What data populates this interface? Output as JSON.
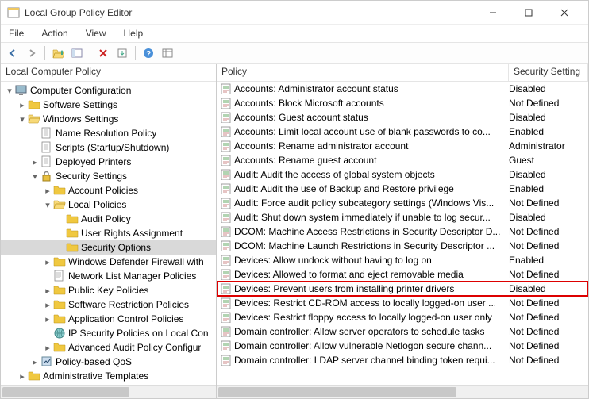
{
  "window": {
    "title": "Local Group Policy Editor"
  },
  "menu": {
    "file": "File",
    "action": "Action",
    "view": "View",
    "help": "Help"
  },
  "tree_header": "Local Computer Policy",
  "tree": [
    {
      "indent": 0,
      "tw": "▾",
      "label": "Computer Configuration",
      "icon": "computer",
      "sel": false
    },
    {
      "indent": 1,
      "tw": "▸",
      "label": "Software Settings",
      "icon": "folder",
      "sel": false
    },
    {
      "indent": 1,
      "tw": "▾",
      "label": "Windows Settings",
      "icon": "folder-open",
      "sel": false
    },
    {
      "indent": 2,
      "tw": "",
      "label": "Name Resolution Policy",
      "icon": "page",
      "sel": false
    },
    {
      "indent": 2,
      "tw": "",
      "label": "Scripts (Startup/Shutdown)",
      "icon": "page",
      "sel": false
    },
    {
      "indent": 2,
      "tw": "▸",
      "label": "Deployed Printers",
      "icon": "page",
      "sel": false
    },
    {
      "indent": 2,
      "tw": "▾",
      "label": "Security Settings",
      "icon": "lock",
      "sel": false
    },
    {
      "indent": 3,
      "tw": "▸",
      "label": "Account Policies",
      "icon": "folder",
      "sel": false
    },
    {
      "indent": 3,
      "tw": "▾",
      "label": "Local Policies",
      "icon": "folder-open",
      "sel": false
    },
    {
      "indent": 4,
      "tw": "",
      "label": "Audit Policy",
      "icon": "folder",
      "sel": false
    },
    {
      "indent": 4,
      "tw": "",
      "label": "User Rights Assignment",
      "icon": "folder",
      "sel": false
    },
    {
      "indent": 4,
      "tw": "",
      "label": "Security Options",
      "icon": "folder",
      "sel": true
    },
    {
      "indent": 3,
      "tw": "▸",
      "label": "Windows Defender Firewall with",
      "icon": "folder",
      "sel": false
    },
    {
      "indent": 3,
      "tw": "",
      "label": "Network List Manager Policies",
      "icon": "page",
      "sel": false
    },
    {
      "indent": 3,
      "tw": "▸",
      "label": "Public Key Policies",
      "icon": "folder",
      "sel": false
    },
    {
      "indent": 3,
      "tw": "▸",
      "label": "Software Restriction Policies",
      "icon": "folder",
      "sel": false
    },
    {
      "indent": 3,
      "tw": "▸",
      "label": "Application Control Policies",
      "icon": "folder",
      "sel": false
    },
    {
      "indent": 3,
      "tw": "",
      "label": "IP Security Policies on Local Con",
      "icon": "globe",
      "sel": false
    },
    {
      "indent": 3,
      "tw": "▸",
      "label": "Advanced Audit Policy Configur",
      "icon": "folder",
      "sel": false
    },
    {
      "indent": 2,
      "tw": "▸",
      "label": "Policy-based QoS",
      "icon": "pbqos",
      "sel": false
    },
    {
      "indent": 1,
      "tw": "▸",
      "label": "Administrative Templates",
      "icon": "folder",
      "sel": false
    }
  ],
  "columns": {
    "policy": "Policy",
    "setting": "Security Setting"
  },
  "policies": [
    {
      "name": "Accounts: Administrator account status",
      "setting": "Disabled",
      "hl": false
    },
    {
      "name": "Accounts: Block Microsoft accounts",
      "setting": "Not Defined",
      "hl": false
    },
    {
      "name": "Accounts: Guest account status",
      "setting": "Disabled",
      "hl": false
    },
    {
      "name": "Accounts: Limit local account use of blank passwords to co...",
      "setting": "Enabled",
      "hl": false
    },
    {
      "name": "Accounts: Rename administrator account",
      "setting": "Administrator",
      "hl": false
    },
    {
      "name": "Accounts: Rename guest account",
      "setting": "Guest",
      "hl": false
    },
    {
      "name": "Audit: Audit the access of global system objects",
      "setting": "Disabled",
      "hl": false
    },
    {
      "name": "Audit: Audit the use of Backup and Restore privilege",
      "setting": "Enabled",
      "hl": false
    },
    {
      "name": "Audit: Force audit policy subcategory settings (Windows Vis...",
      "setting": "Not Defined",
      "hl": false
    },
    {
      "name": "Audit: Shut down system immediately if unable to log secur...",
      "setting": "Disabled",
      "hl": false
    },
    {
      "name": "DCOM: Machine Access Restrictions in Security Descriptor D...",
      "setting": "Not Defined",
      "hl": false
    },
    {
      "name": "DCOM: Machine Launch Restrictions in Security Descriptor ...",
      "setting": "Not Defined",
      "hl": false
    },
    {
      "name": "Devices: Allow undock without having to log on",
      "setting": "Enabled",
      "hl": false
    },
    {
      "name": "Devices: Allowed to format and eject removable media",
      "setting": "Not Defined",
      "hl": false
    },
    {
      "name": "Devices: Prevent users from installing printer drivers",
      "setting": "Disabled",
      "hl": true
    },
    {
      "name": "Devices: Restrict CD-ROM access to locally logged-on user ...",
      "setting": "Not Defined",
      "hl": false
    },
    {
      "name": "Devices: Restrict floppy access to locally logged-on user only",
      "setting": "Not Defined",
      "hl": false
    },
    {
      "name": "Domain controller: Allow server operators to schedule tasks",
      "setting": "Not Defined",
      "hl": false
    },
    {
      "name": "Domain controller: Allow vulnerable Netlogon secure chann...",
      "setting": "Not Defined",
      "hl": false
    },
    {
      "name": "Domain controller: LDAP server channel binding token requi...",
      "setting": "Not Defined",
      "hl": false
    }
  ]
}
